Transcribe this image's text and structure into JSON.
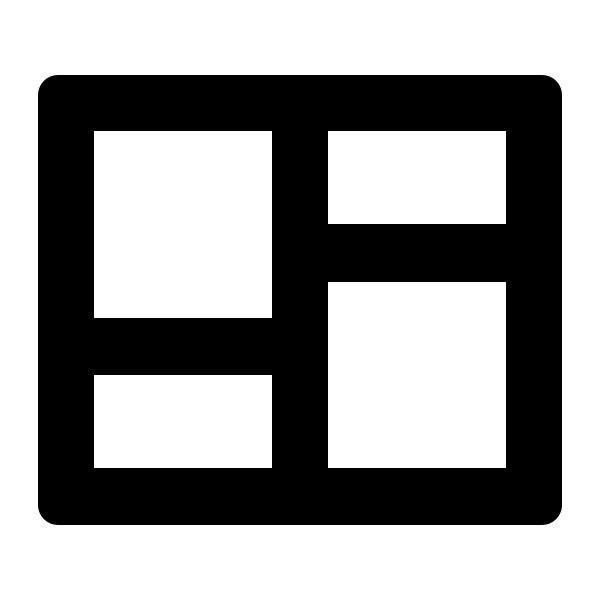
{
  "icon": {
    "name": "dashboard-layout-icon",
    "fill_color": "#000000",
    "background_color": "#ffffff"
  }
}
